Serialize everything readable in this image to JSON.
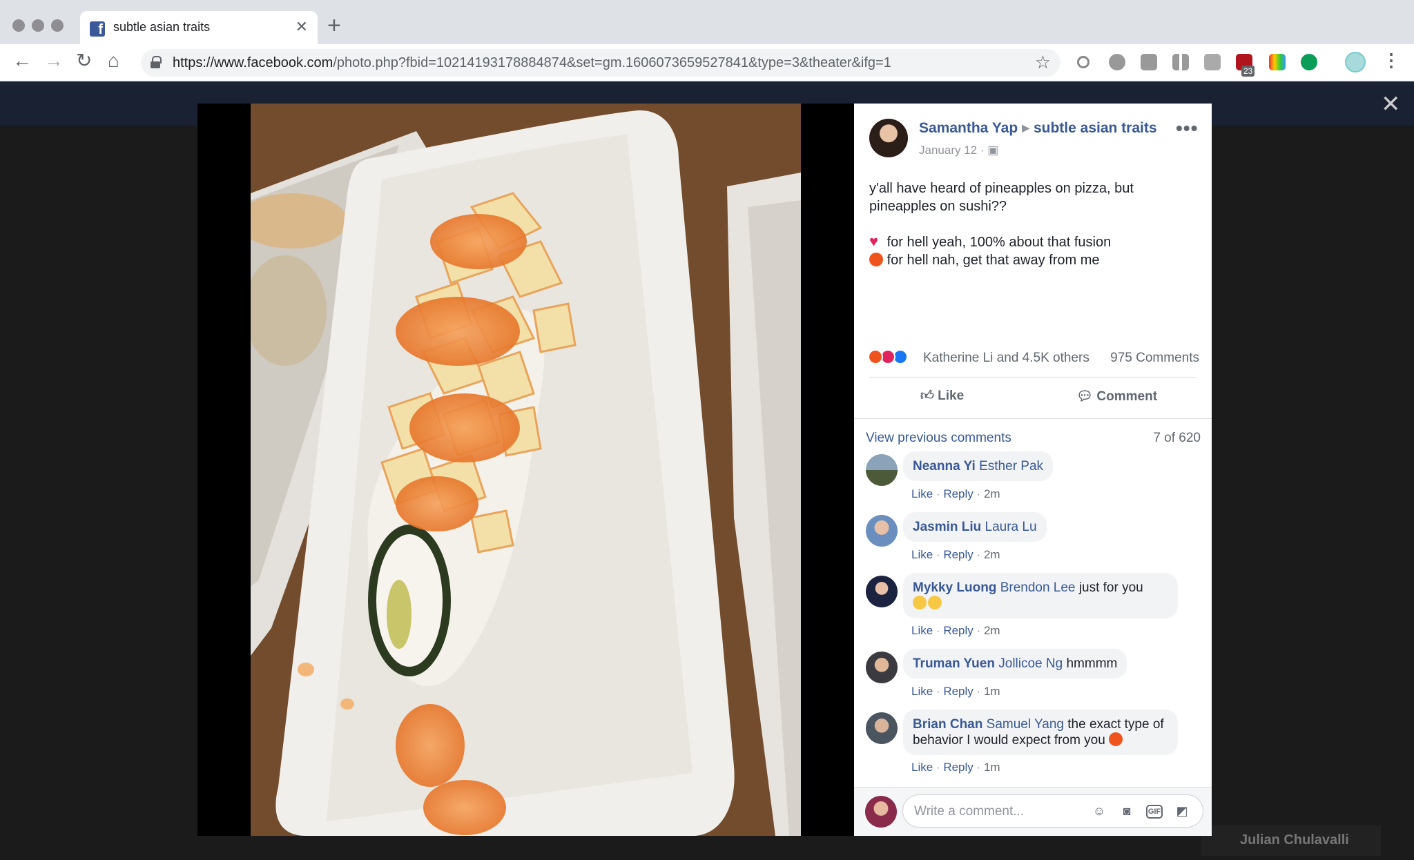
{
  "browser": {
    "tab_title": "subtle asian traits",
    "url_host": "https://www.facebook.com",
    "url_path": "/photo.php?fbid=10214193178884874&set=gm.1606073659527841&type=3&theater&ifg=1",
    "extension_badge": "23"
  },
  "post": {
    "author": "Samantha Yap",
    "group": "subtle asian traits",
    "date": "January 12",
    "text_line1": "y'all have heard of pineapples on pizza, but pineapples on sushi??",
    "option_love": "for hell yeah, 100% about that fusion",
    "option_angry": "for hell nah, get that away from me",
    "reactions_text": "Katherine Li and 4.5K others",
    "comments_count": "975 Comments",
    "like_label": "Like",
    "comment_label": "Comment",
    "view_previous": "View previous comments",
    "page_count": "7 of 620"
  },
  "comments": [
    {
      "author": "Neanna Yi",
      "tag": "Esther Pak",
      "text": "",
      "time": "2m"
    },
    {
      "author": "Jasmin Liu",
      "tag": "Laura Lu",
      "text": "",
      "time": "2m"
    },
    {
      "author": "Mykky Luong",
      "tag": "Brendon Lee",
      "text": "just for you",
      "time": "2m"
    },
    {
      "author": "Truman Yuen",
      "tag": "Jollicoe Ng",
      "text": "hmmmm",
      "time": "1m"
    },
    {
      "author": "Brian Chan",
      "tag": "Samuel Yang",
      "text": "the exact type of behavior I would expect from you",
      "time": "1m"
    }
  ],
  "comment_actions": {
    "like": "Like",
    "reply": "Reply",
    "sep": "·"
  },
  "composer": {
    "placeholder": "Write a comment..."
  },
  "background": {
    "chat_name": "Julian Chulavalli"
  },
  "colors": {
    "fb_blue": "#385898",
    "fb_brand": "#3b5998",
    "reaction_angry": "#f0541e",
    "reaction_love": "#e0245e",
    "reaction_like": "#1877f2"
  }
}
